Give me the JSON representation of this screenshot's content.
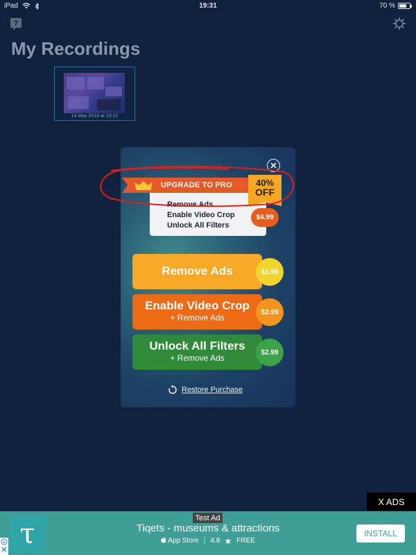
{
  "status_bar": {
    "device": "iPad",
    "time": "19:31",
    "battery": "70 %",
    "battery_level": 0.7
  },
  "header": {
    "title": "My Recordings",
    "help_icon": "question-icon",
    "settings_icon": "gear-icon"
  },
  "recordings": [
    {
      "date": "14 May 2018 at 15:22"
    }
  ],
  "modal": {
    "banner": "UPGRADE TO PRO",
    "discount_pct": "40%",
    "discount_off": "OFF",
    "features": [
      "Remove Ads",
      "Enable Video Crop",
      "Unlock All Filters"
    ],
    "bundle_price": "$4.99",
    "options": [
      {
        "title": "Remove Ads",
        "subtitle": "",
        "price": "$1.99"
      },
      {
        "title": "Enable Video Crop",
        "subtitle": "+ Remove Ads",
        "price": "$2.99"
      },
      {
        "title": "Unlock All Filters",
        "subtitle": "+ Remove Ads",
        "price": "$2.99"
      }
    ],
    "restore": "Restore Purchase",
    "colors": {
      "remove": "#f6a826",
      "crop": "#ed6b17",
      "filters": "#2f8a3a",
      "banner": "#e5582a"
    }
  },
  "ads": {
    "close_label": "X ADS",
    "test_label": "Test Ad",
    "title": "Tiqets - museums & attractions",
    "store": "App Store",
    "rating": "4.8",
    "price": "FREE",
    "install": "INSTALL",
    "logo_letter": "τ"
  }
}
